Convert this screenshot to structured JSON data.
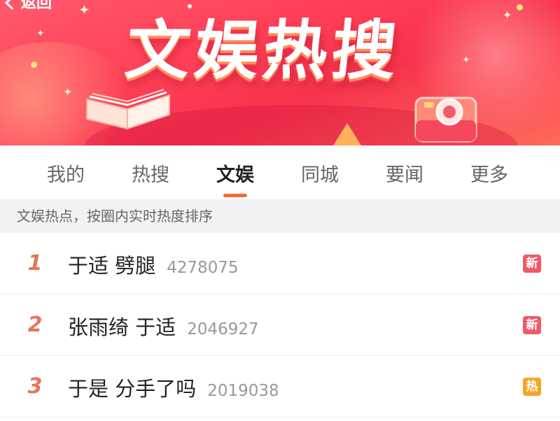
{
  "header": {
    "back_label": "返回",
    "banner_title": "文娱热搜"
  },
  "tabs": [
    {
      "label": "我的",
      "active": false
    },
    {
      "label": "热搜",
      "active": false
    },
    {
      "label": "文娱",
      "active": true
    },
    {
      "label": "同城",
      "active": false
    },
    {
      "label": "要闻",
      "active": false
    },
    {
      "label": "更多",
      "active": false
    }
  ],
  "subheader": "文娱热点，按圈内实时热度排序",
  "items": [
    {
      "rank": "1",
      "title": "于适 劈腿",
      "count": "4278075",
      "badge": "新",
      "badge_color": "#ef5a68"
    },
    {
      "rank": "2",
      "title": "张雨绮 于适",
      "count": "2046927",
      "badge": "新",
      "badge_color": "#ef5a68"
    },
    {
      "rank": "3",
      "title": "于是 分手了吗",
      "count": "2019038",
      "badge": "热",
      "badge_color": "#f5a623"
    }
  ],
  "colors": {
    "accent": "#f26b2f",
    "rank": "#e8745a"
  }
}
